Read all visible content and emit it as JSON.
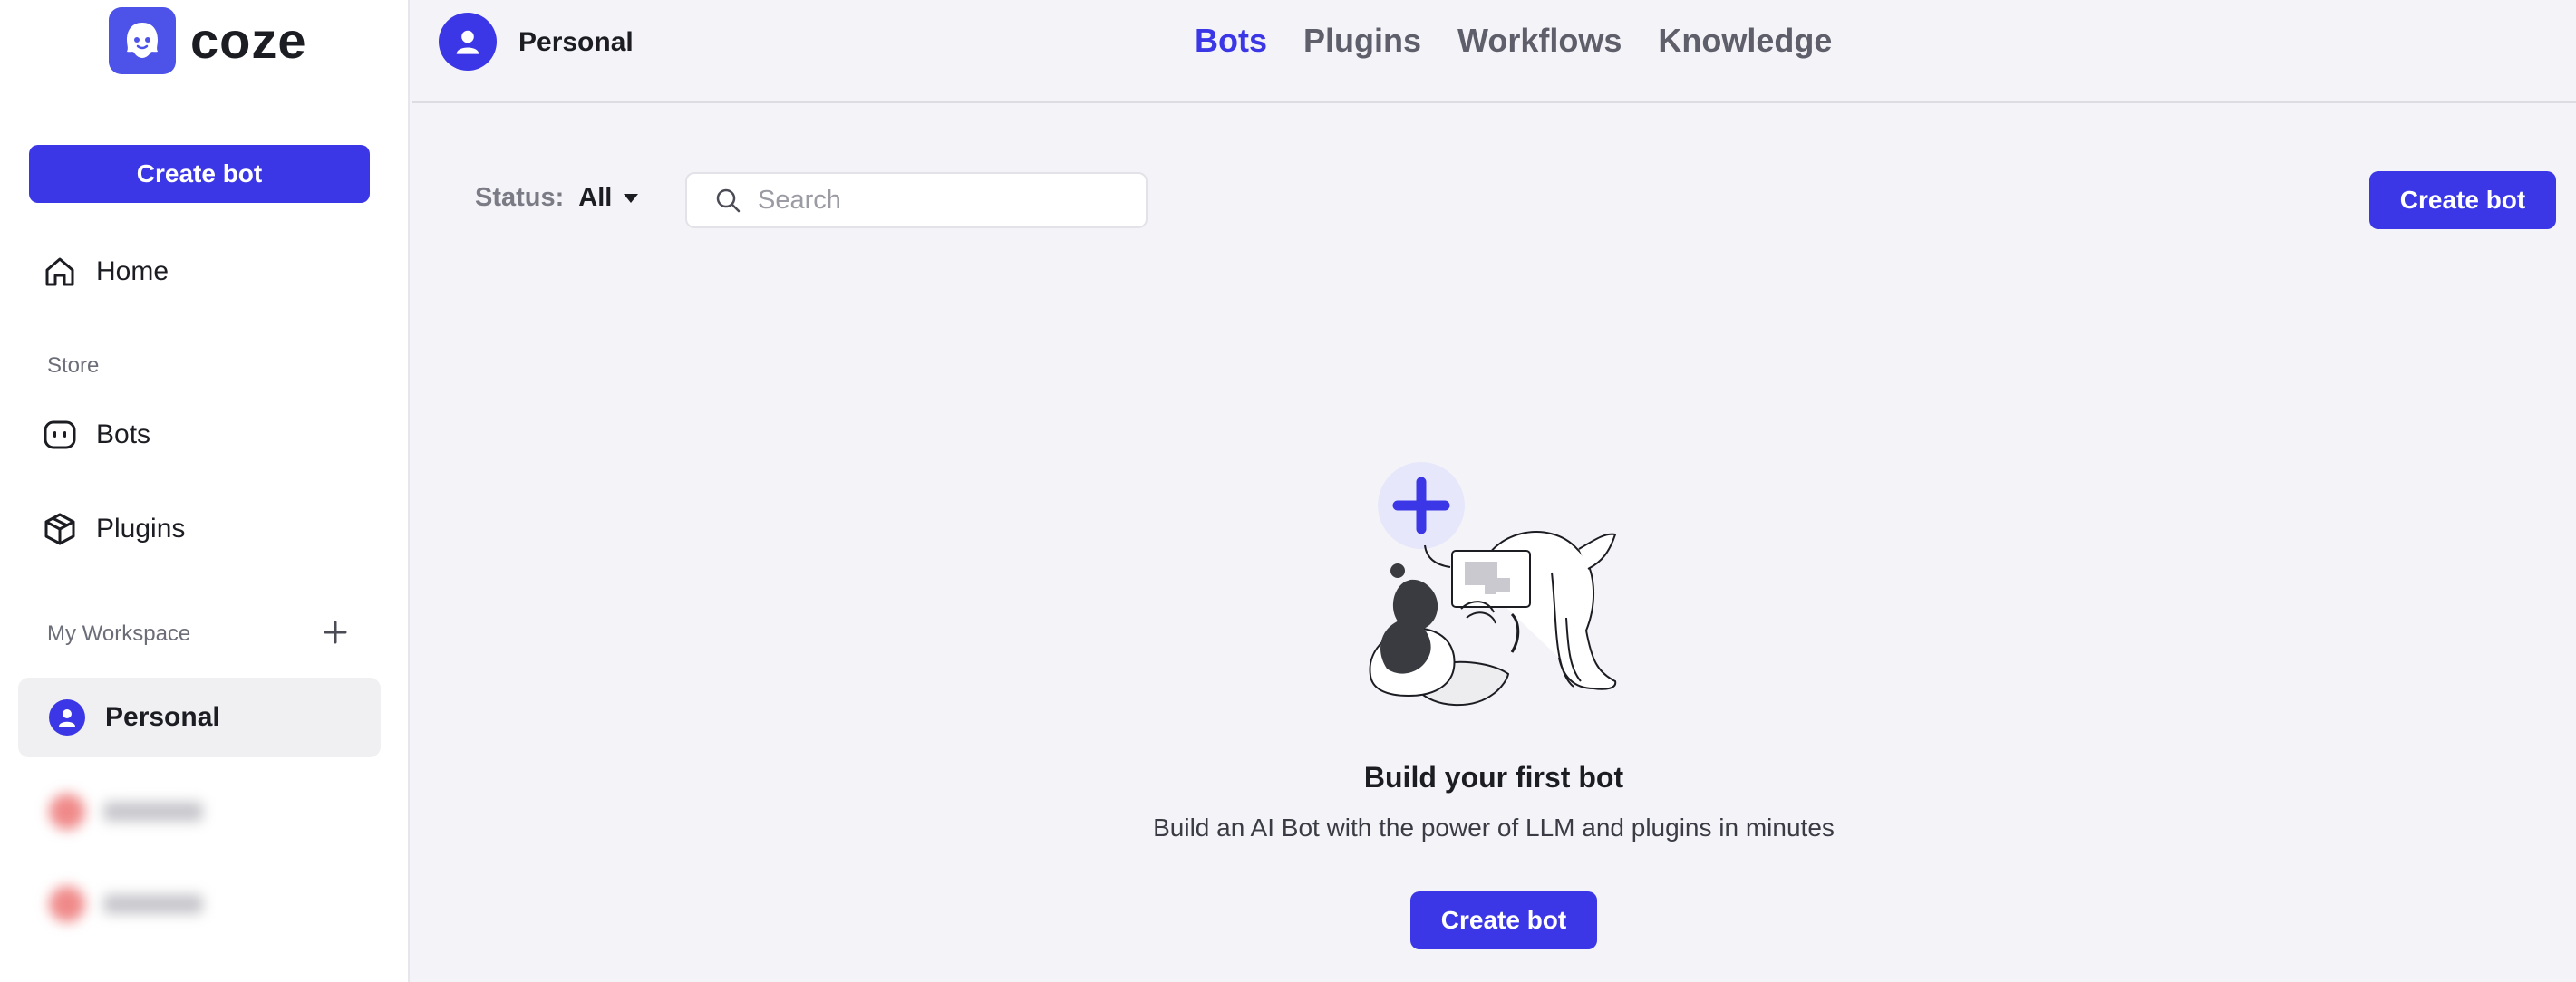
{
  "brand": {
    "name": "coze",
    "accent_color": "#3b37e6",
    "logo_icon": "coze-logo-icon"
  },
  "sidebar": {
    "create_bot_label": "Create bot",
    "home_label": "Home",
    "store_section": "Store",
    "store_items": [
      {
        "label": "Bots",
        "icon": "bot-face-icon"
      },
      {
        "label": "Plugins",
        "icon": "cube-icon"
      }
    ],
    "workspace_section": "My Workspace",
    "workspace_add_icon": "plus-icon",
    "workspaces": [
      {
        "label": "Personal",
        "active": true
      }
    ]
  },
  "topbar": {
    "space_name": "Personal",
    "tabs": [
      {
        "label": "Bots",
        "active": true
      },
      {
        "label": "Plugins",
        "active": false
      },
      {
        "label": "Workflows",
        "active": false
      },
      {
        "label": "Knowledge",
        "active": false
      }
    ]
  },
  "filters": {
    "status_label": "Status:",
    "status_value": "All",
    "search_placeholder": "Search",
    "search_value": "",
    "create_bot_label": "Create bot"
  },
  "empty_state": {
    "title": "Build your first bot",
    "description": "Build an AI Bot with the power of LLM and plugins in minutes",
    "create_bot_label": "Create bot"
  }
}
